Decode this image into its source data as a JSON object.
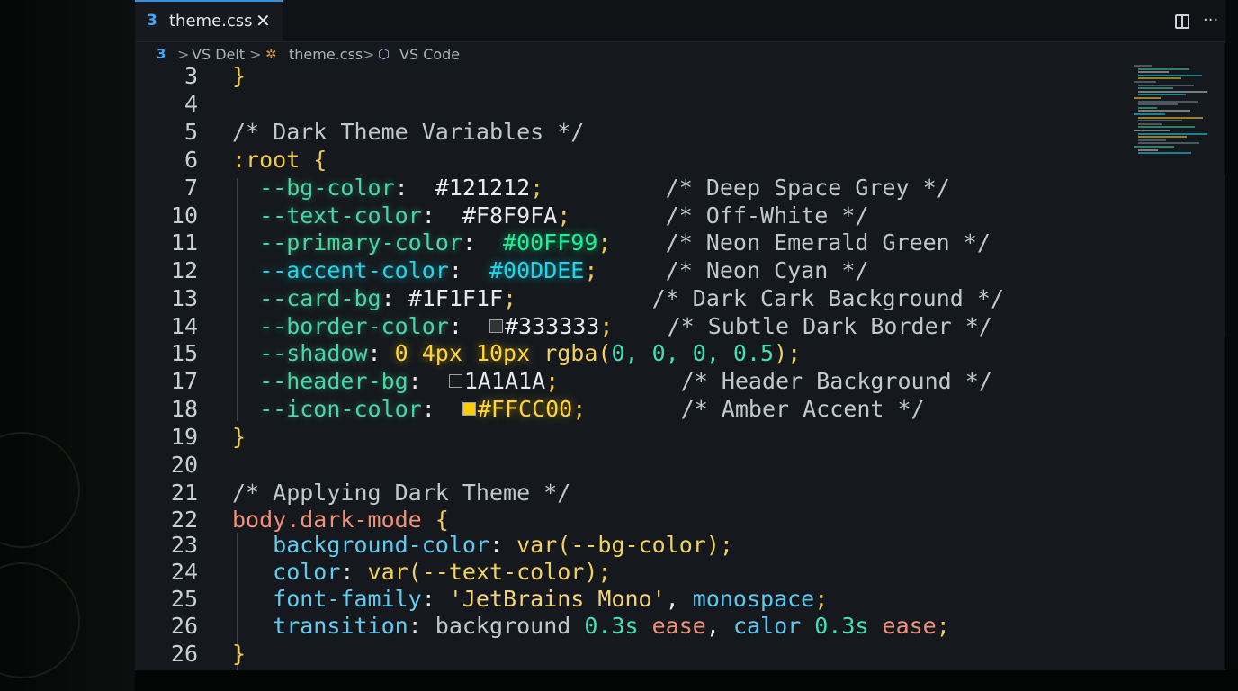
{
  "tab": {
    "label": "theme.css",
    "close": "✕",
    "icon": "css3-icon"
  },
  "breadcrumb": {
    "items": [
      "VS Delt",
      "theme.css",
      "VS Code"
    ],
    "separator": ">"
  },
  "lines": [
    {
      "n": "3",
      "segments": [
        {
          "t": "}",
          "c": "c-brace"
        }
      ]
    },
    {
      "n": "4",
      "segments": []
    },
    {
      "n": "5",
      "segments": [
        {
          "t": "/* Dark Theme Variables */",
          "c": "c-comment"
        }
      ]
    },
    {
      "n": "6",
      "segments": [
        {
          "t": ":root {",
          "c": "c-sel"
        }
      ]
    },
    {
      "n": "7",
      "segments": [
        {
          "t": "  --bg-color",
          "c": "c-var"
        },
        {
          "t": ":  ",
          "c": "c-val"
        },
        {
          "t": "#121212",
          "c": "c-val"
        },
        {
          "t": ";",
          "c": "c-punc"
        },
        {
          "t": "         /* Deep Space Grey */",
          "c": "c-comment"
        }
      ]
    },
    {
      "n": "10",
      "segments": [
        {
          "t": "  --text-color",
          "c": "c-var"
        },
        {
          "t": ":  ",
          "c": "c-val"
        },
        {
          "t": "#F8F9FA",
          "c": "c-val"
        },
        {
          "t": ";",
          "c": "c-punc"
        },
        {
          "t": "       /* Off-White */",
          "c": "c-comment"
        }
      ]
    },
    {
      "n": "11",
      "segments": [
        {
          "t": "  --primary-color",
          "c": "c-var"
        },
        {
          "t": ":  ",
          "c": "c-val"
        },
        {
          "t": "#00FF99",
          "c": "c-green"
        },
        {
          "t": ";",
          "c": "c-punc"
        },
        {
          "t": "    /* Neon Emerald Green */",
          "c": "c-comment"
        }
      ]
    },
    {
      "n": "12",
      "segments": [
        {
          "t": "  --accent-color",
          "c": "c-cyan"
        },
        {
          "t": ":  ",
          "c": "c-val"
        },
        {
          "t": "#00DDEE",
          "c": "c-cyan"
        },
        {
          "t": ";",
          "c": "c-punc"
        },
        {
          "t": "     /* Neon Cyan */",
          "c": "c-comment"
        }
      ]
    },
    {
      "n": "13",
      "segments": [
        {
          "t": "  --card-bg",
          "c": "c-var"
        },
        {
          "t": ": ",
          "c": "c-val"
        },
        {
          "t": "#1F1F1F",
          "c": "c-val"
        },
        {
          "t": ";",
          "c": "c-punc"
        },
        {
          "t": "          /* Dark Cark Background */",
          "c": "c-comment"
        }
      ]
    },
    {
      "n": "14",
      "segments": [
        {
          "t": "  --border-color",
          "c": "c-var"
        },
        {
          "t": ":  ",
          "c": "c-val"
        },
        {
          "sw": "#333333"
        },
        {
          "t": "#333333",
          "c": "c-val"
        },
        {
          "t": ";",
          "c": "c-punc"
        },
        {
          "t": "    /* Subtle Dark Border */",
          "c": "c-comment"
        }
      ]
    },
    {
      "n": "15",
      "segments": [
        {
          "t": "  --shadow",
          "c": "c-var"
        },
        {
          "t": ": ",
          "c": "c-val"
        },
        {
          "t": "0 4px 10px ",
          "c": "c-yellow"
        },
        {
          "t": "rgba(",
          "c": "c-func"
        },
        {
          "t": "0, 0, 0, 0.5",
          "c": "c-num"
        },
        {
          "t": ");",
          "c": "c-func"
        }
      ]
    },
    {
      "n": "17",
      "segments": [
        {
          "t": "  --header-bg",
          "c": "c-var"
        },
        {
          "t": ":  ",
          "c": "c-val"
        },
        {
          "sw": "#1A1A1A"
        },
        {
          "t": "1A1A1A",
          "c": "c-val"
        },
        {
          "t": ";",
          "c": "c-punc"
        },
        {
          "t": "         /* Header Background */",
          "c": "c-comment"
        }
      ]
    },
    {
      "n": "18",
      "segments": [
        {
          "t": "  --icon-color",
          "c": "c-var"
        },
        {
          "t": ":  ",
          "c": "c-val"
        },
        {
          "sw": "#FFCC00"
        },
        {
          "t": "#FFCC00",
          "c": "c-yellow"
        },
        {
          "t": ";",
          "c": "c-punc"
        },
        {
          "t": "       /* Amber Accent */",
          "c": "c-comment"
        }
      ]
    },
    {
      "n": "19",
      "segments": [
        {
          "t": "}",
          "c": "c-brace"
        }
      ]
    },
    {
      "n": "20",
      "segments": []
    },
    {
      "n": "21",
      "segments": [
        {
          "t": "/* Applying Dark Theme */",
          "c": "c-comment"
        }
      ]
    },
    {
      "n": "22",
      "segments": [
        {
          "t": "body.dark-mode ",
          "c": "c-ease"
        },
        {
          "t": "{",
          "c": "c-brace"
        }
      ]
    },
    {
      "n": "23",
      "segments": [
        {
          "t": "   background-color",
          "c": "c-prop"
        },
        {
          "t": ": ",
          "c": "c-val"
        },
        {
          "t": "var(",
          "c": "c-func"
        },
        {
          "t": "--bg-color",
          "c": "c-func"
        },
        {
          "t": ");",
          "c": "c-func"
        }
      ]
    },
    {
      "n": "24",
      "segments": [
        {
          "t": "   color",
          "c": "c-prop"
        },
        {
          "t": ": ",
          "c": "c-val"
        },
        {
          "t": "var(--text-color);",
          "c": "c-func"
        }
      ]
    },
    {
      "n": "25",
      "segments": [
        {
          "t": "   font-family",
          "c": "c-prop"
        },
        {
          "t": ": ",
          "c": "c-val"
        },
        {
          "t": "'JetBrains Mono'",
          "c": "c-str"
        },
        {
          "t": ", ",
          "c": "c-val"
        },
        {
          "t": "monospace",
          "c": "c-kw"
        },
        {
          "t": ";",
          "c": "c-punc"
        }
      ]
    },
    {
      "n": "26",
      "segments": [
        {
          "t": "   transition",
          "c": "c-prop"
        },
        {
          "t": ": ",
          "c": "c-val"
        },
        {
          "t": "background ",
          "c": "c-comment"
        },
        {
          "t": "0.3s ",
          "c": "c-num"
        },
        {
          "t": "ease",
          "c": "c-ease"
        },
        {
          "t": ", ",
          "c": "c-val"
        },
        {
          "t": "calor ",
          "c": "c-kw"
        },
        {
          "t": "0.3s ",
          "c": "c-num"
        },
        {
          "t": "ease",
          "c": "c-ease"
        },
        {
          "t": ";",
          "c": "c-punc"
        }
      ]
    },
    {
      "n": "26",
      "segments": [
        {
          "t": "}",
          "c": "c-brace"
        }
      ]
    }
  ]
}
